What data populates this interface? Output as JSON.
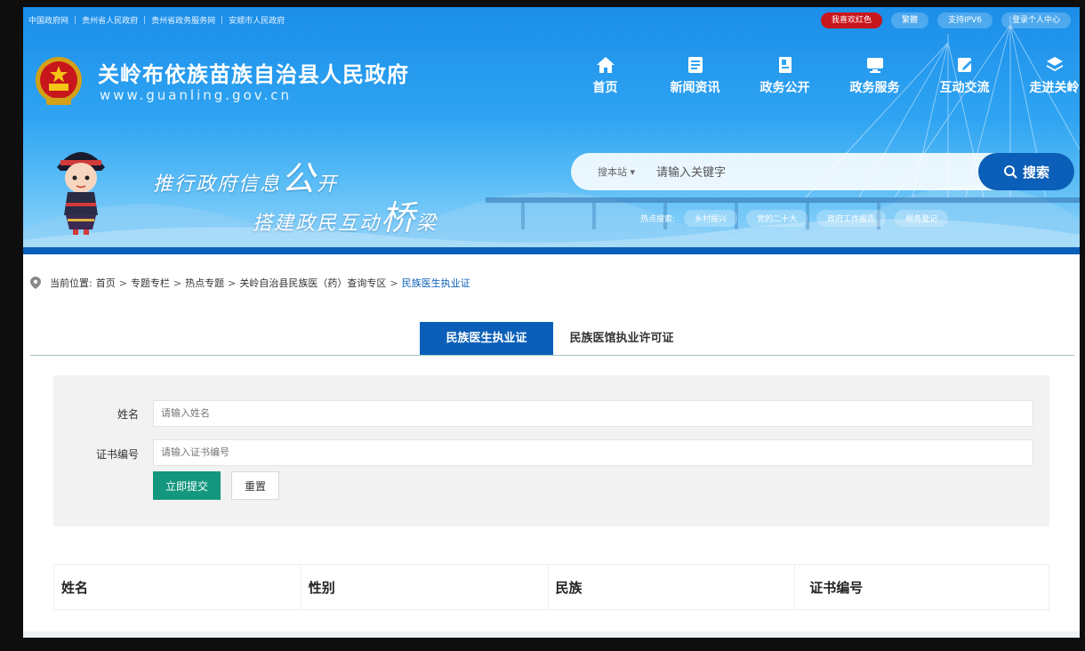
{
  "top_links": [
    "中国政府网",
    "贵州省人民政府",
    "贵州省政务服务网",
    "安顺市人民政府"
  ],
  "top_right": [
    "我喜欢红色",
    "繁體",
    "支持IPV6",
    "登录个人中心"
  ],
  "site": {
    "title": "关岭布依族苗族自治县人民政府",
    "url": "www.guanling.gov.cn"
  },
  "nav": [
    {
      "label": "首页",
      "icon": "home-icon"
    },
    {
      "label": "新闻资讯",
      "icon": "news-icon"
    },
    {
      "label": "政务公开",
      "icon": "document-icon"
    },
    {
      "label": "政务服务",
      "icon": "service-icon"
    },
    {
      "label": "互动交流",
      "icon": "edit-icon"
    },
    {
      "label": "走进关岭",
      "icon": "layers-icon"
    }
  ],
  "slogan": {
    "line1_a": "推行政府信息",
    "line1_b": "公",
    "line1_c": "开",
    "line2_a": "搭建政民互动",
    "line2_b": "桥",
    "line2_c": "梁"
  },
  "search": {
    "scope": "搜本站",
    "placeholder": "请输入关键字",
    "button": "搜索"
  },
  "hot": {
    "label": "热点搜索:",
    "items": [
      "乡村振兴",
      "党的二十大",
      "政府工作报告",
      "税务登记"
    ]
  },
  "breadcrumb": {
    "label": "当前位置:",
    "items": [
      "首页",
      "专题专栏",
      "热点专题",
      "关岭自治县民族医（药）查询专区"
    ],
    "current": "民族医生执业证"
  },
  "tabs": [
    "民族医生执业证",
    "民族医馆执业许可证"
  ],
  "form": {
    "name_label": "姓名",
    "name_placeholder": "请输入姓名",
    "cert_label": "证书编号",
    "cert_placeholder": "请输入证书编号",
    "submit": "立即提交",
    "reset": "重置"
  },
  "table": {
    "headers": [
      "姓名",
      "性别",
      "民族",
      "证书编号"
    ]
  },
  "colors": {
    "header_blue": "#1b8ee9",
    "dark_blue": "#0b5fb8",
    "red": "#c8161d",
    "green": "#14977f"
  }
}
